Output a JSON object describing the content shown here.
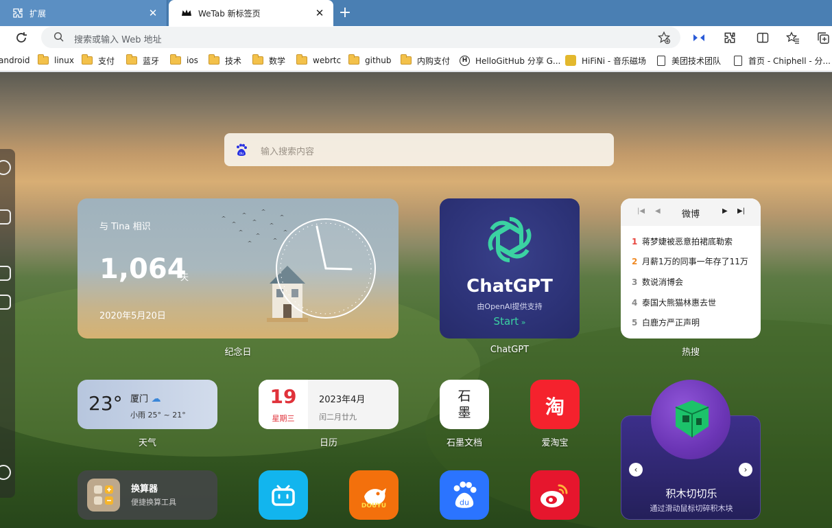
{
  "tabs": [
    {
      "title": "扩展",
      "icon": "puzzle-icon"
    },
    {
      "title": "WeTab 新标签页",
      "icon": "wetab-crown-icon"
    }
  ],
  "toolbar": {
    "address_placeholder": "搜索或输入 Web 地址"
  },
  "bookmarks": [
    {
      "label": "android",
      "icon": "none"
    },
    {
      "label": "linux",
      "icon": "folder-icon"
    },
    {
      "label": "支付",
      "icon": "folder-icon"
    },
    {
      "label": "蓝牙",
      "icon": "folder-icon"
    },
    {
      "label": "ios",
      "icon": "folder-icon"
    },
    {
      "label": "技术",
      "icon": "folder-icon"
    },
    {
      "label": "数学",
      "icon": "folder-icon"
    },
    {
      "label": "webrtc",
      "icon": "folder-icon"
    },
    {
      "label": "github",
      "icon": "folder-icon"
    },
    {
      "label": "内购支付",
      "icon": "folder-icon"
    },
    {
      "label": "HelloGitHub 分享 G...",
      "icon": "hellogithub-icon"
    },
    {
      "label": "HiFiNi - 音乐磁场",
      "icon": "hifini-icon"
    },
    {
      "label": "美团技术团队",
      "icon": "page-icon"
    },
    {
      "label": "首页 - Chiphell - 分...",
      "icon": "page-icon"
    }
  ],
  "search": {
    "placeholder": "输入搜索内容"
  },
  "anniversary": {
    "meet": "与 Tina 相识",
    "days": "1,064",
    "unit": "天",
    "date": "2020年5月20日",
    "label": "纪念日"
  },
  "chatgpt": {
    "name": "ChatGPT",
    "subtitle": "由OpenAI提供支持",
    "start": "Start",
    "label": "ChatGPT",
    "accent": "#3bd2a2"
  },
  "hot": {
    "title": "微博",
    "label": "热搜",
    "items": [
      {
        "rank": "1",
        "text": "蒋梦婕被恶意拍裙底勒索",
        "color": "#e8463f"
      },
      {
        "rank": "2",
        "text": "月薪1万的同事一年存了11万",
        "color": "#f08a24"
      },
      {
        "rank": "3",
        "text": "数说消博会",
        "color": "#888888"
      },
      {
        "rank": "4",
        "text": "泰国大熊猫林惠去世",
        "color": "#888888"
      },
      {
        "rank": "5",
        "text": "白鹿方严正声明",
        "color": "#888888"
      }
    ]
  },
  "weather": {
    "temp": "23°",
    "city": "厦门",
    "condition": "小雨 25° ~ 21°",
    "label": "天气"
  },
  "calendar": {
    "day": "19",
    "weekday": "星期三",
    "year_month": "2023年4月",
    "lunar": "闰二月廿九",
    "label": "日历"
  },
  "apps": {
    "shimo": {
      "logo": "石\n墨",
      "label": "石墨文档"
    },
    "taobao": {
      "logo": "淘",
      "label": "爱淘宝"
    }
  },
  "game": {
    "title": "积木切切乐",
    "subtitle": "通过滑动鼠标切碎积木块"
  },
  "calculator": {
    "name": "换算器",
    "desc": "便捷换算工具"
  },
  "colors": {
    "tab_strip": "#4a7fb3",
    "chatgpt_bg": "#2d3378",
    "taobao": "#f5222d",
    "weibo": "#e6162d",
    "baidu": "#2b74ff",
    "bilibili": "#12b5ee",
    "douyu": "#f3700c"
  }
}
